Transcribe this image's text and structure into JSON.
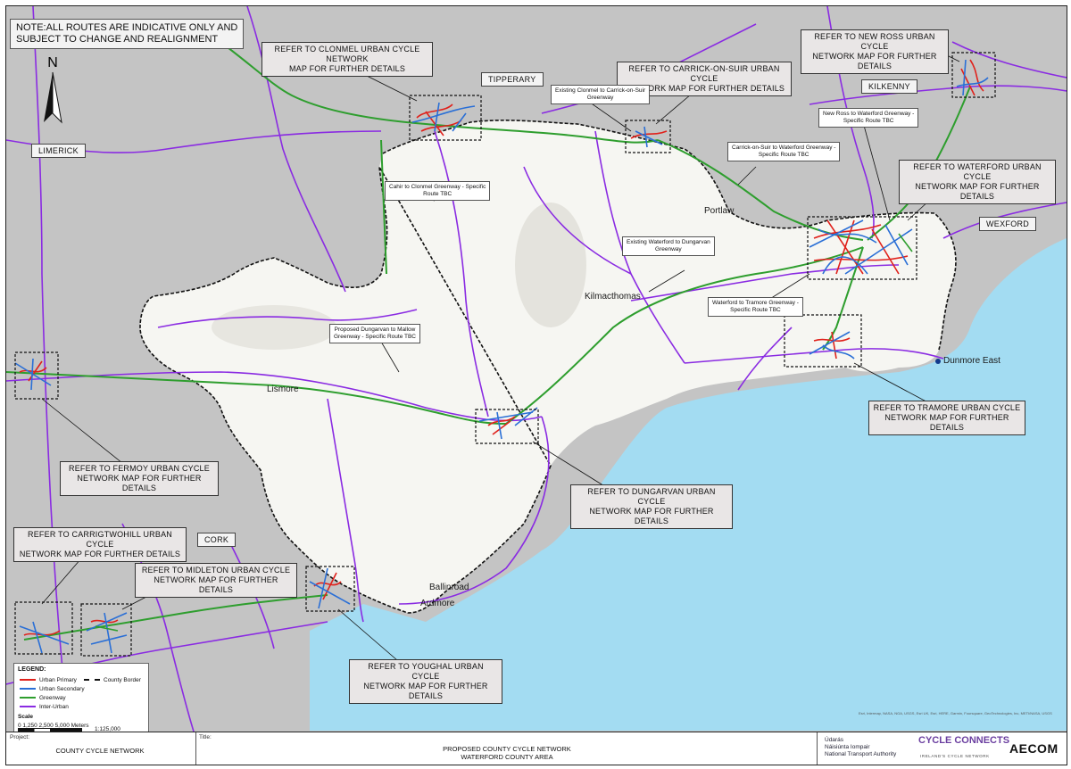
{
  "note": [
    "NOTE:ALL ROUTES ARE INDICATIVE ONLY AND",
    "SUBJECT TO CHANGE AND REALIGNMENT"
  ],
  "north_label": "N",
  "counties": {
    "limerick": "LIMERICK",
    "tipperary": "TIPPERARY",
    "kilkenny": "KILKENNY",
    "wexford": "WEXFORD",
    "cork": "CORK"
  },
  "callouts": {
    "clonmel": [
      "REFER TO CLONMEL URBAN CYCLE NETWORK",
      "MAP FOR FURTHER DETAILS"
    ],
    "carrick": [
      "REFER TO CARRICK-ON-SUIR URBAN CYCLE",
      "NETWORK MAP FOR FURTHER DETAILS"
    ],
    "new_ross": [
      "REFER TO NEW ROSS URBAN CYCLE",
      "NETWORK MAP FOR FURTHER DETAILS"
    ],
    "waterford": [
      "REFER TO WATERFORD URBAN CYCLE",
      "NETWORK MAP FOR FURTHER DETAILS"
    ],
    "tramore": [
      "REFER TO TRAMORE URBAN CYCLE",
      "NETWORK MAP FOR FURTHER DETAILS"
    ],
    "dungarvan": [
      "REFER TO DUNGARVAN URBAN CYCLE",
      "NETWORK MAP FOR FURTHER DETAILS"
    ],
    "fermoy": [
      "REFER TO FERMOY URBAN CYCLE",
      "NETWORK MAP FOR FURTHER DETAILS"
    ],
    "carrigtwohill": [
      "REFER TO CARRIGTWOHILL URBAN CYCLE",
      "NETWORK MAP FOR FURTHER DETAILS"
    ],
    "midleton": [
      "REFER TO MIDLETON URBAN CYCLE",
      "NETWORK MAP FOR FURTHER DETAILS"
    ],
    "youghal": [
      "REFER TO YOUGHAL URBAN CYCLE",
      "NETWORK MAP FOR FURTHER DETAILS"
    ]
  },
  "greenway_labels": {
    "clonmel_carrick": [
      "Existing Clonmel to Carrick-on-Suir",
      "Greenway"
    ],
    "new_ross_waterford": [
      "New Ross to Waterford Greenway -",
      "Specific Route TBC"
    ],
    "carrick_waterford": [
      "Carrick-on-Suir to Waterford Greenway -",
      "Specific Route TBC"
    ],
    "cahir_clonmel": [
      "Cahir to Clonmel Greenway - Specific",
      "Route TBC"
    ],
    "waterford_dungarvan": [
      "Existing Waterford to Dungarvan",
      "Greenway"
    ],
    "waterford_tramore": [
      "Waterford to Tramore Greenway -",
      "Specific Route TBC"
    ],
    "dungarvan_mallow": [
      "Proposed Dungarvan to Mallow",
      "Greenway - Specific Route TBC"
    ]
  },
  "places": {
    "portlaw": "Portlaw",
    "kilmacthomas": "Kilmacthomas",
    "lismore": "Lismore",
    "dunmore_east": "Dunmore East",
    "ballinroad": "Ballinroad",
    "ardmore": "Ardmore"
  },
  "legend": {
    "title": "LEGEND:",
    "items": [
      {
        "label": "Urban Primary",
        "color": "#e0211b"
      },
      {
        "label": "Urban Secondary",
        "color": "#2a6fd6"
      },
      {
        "label": "Greenway",
        "color": "#2e9e2e"
      },
      {
        "label": "Inter-Urban",
        "color": "#8a2be2"
      }
    ],
    "border_label": "County Border"
  },
  "scale": {
    "title": "Scale",
    "ticks": "0   1,250 2,500        5,000 Meters",
    "ratio": "1:125,000"
  },
  "credits": "Esri, Intermap, NASA, NGA, USGS, Esri UK, Esri, HERE, Garmin, Foursquare, GeoTechnologies, Inc, METI/NASA, USGS",
  "title_block": {
    "project_label": "Project:",
    "project_value": "COUNTY CYCLE NETWORK",
    "title_label": "Title:",
    "title_line1": "PROPOSED COUNTY CYCLE NETWORK",
    "title_line2": "WATERFORD COUNTY AREA",
    "logo1_line1": "Údarás",
    "logo1_line2": "Náisiúnta Iompair",
    "logo1_line3": "National Transport Authority",
    "logo2": "CYCLE CONNECTS",
    "logo2_sub": "IRELAND'S CYCLE NETWORK",
    "logo3": "AECOM"
  },
  "colors": {
    "sea": "#a3dcf2",
    "land_waterford": "#f6f6f2",
    "land_outside": "#c2c2c2",
    "inter_urban": "#8a2be2",
    "greenway": "#2e9e2e",
    "urban_primary": "#e0211b",
    "urban_secondary": "#2a6fd6"
  }
}
